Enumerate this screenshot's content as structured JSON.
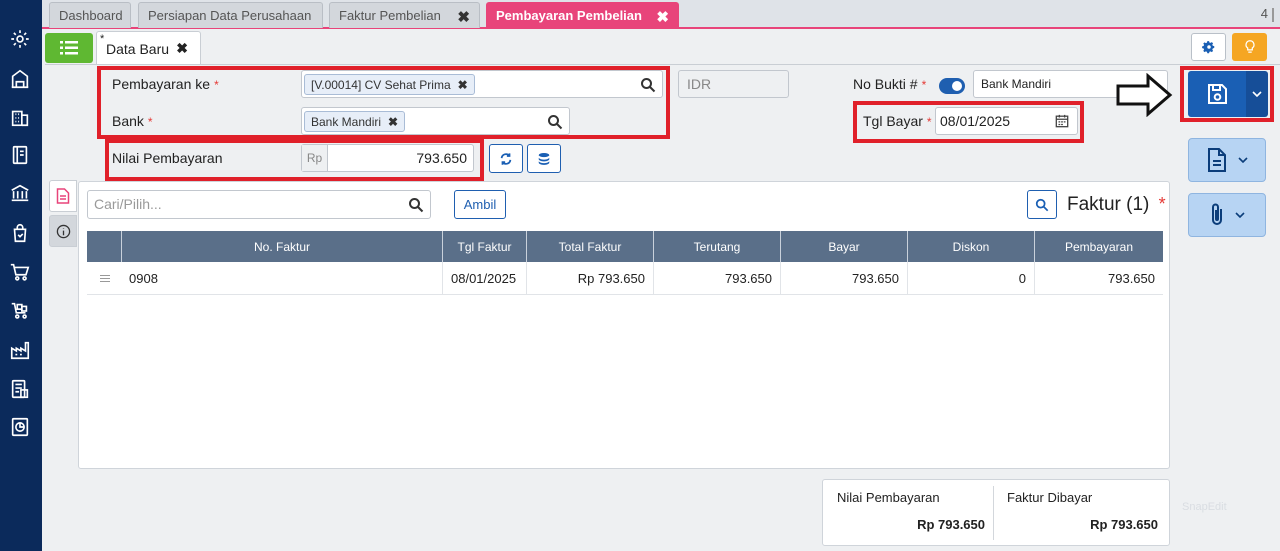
{
  "top_tabs": [
    {
      "label": "Dashboard",
      "closable": false
    },
    {
      "label": "Persiapan Data Perusahaan",
      "closable": false
    },
    {
      "label": "Faktur Pembelian",
      "closable": true
    },
    {
      "label": "Pembayaran Pembelian",
      "closable": true,
      "active": true
    }
  ],
  "tab_count": "4",
  "doc_tab": {
    "modified_mark": "*",
    "label": "Data Baru",
    "close": "✖"
  },
  "close_glyph": "✖",
  "form": {
    "pembayaran_ke": {
      "label": "Pembayaran ke",
      "required": "*",
      "value": "[V.00014] CV Sehat Prima",
      "chip_close": "✖"
    },
    "currency": "IDR",
    "bank": {
      "label": "Bank",
      "required": "*",
      "value": "Bank Mandiri",
      "chip_close": "✖"
    },
    "nilai_pembayaran": {
      "label": "Nilai Pembayaran",
      "prefix": "Rp",
      "value": "793.650"
    },
    "no_bukti": {
      "label": "No Bukti #",
      "required": "*",
      "value": "Bank Mandiri"
    },
    "tgl_bayar": {
      "label": "Tgl Bayar",
      "required": "*",
      "value": "08/01/2025"
    }
  },
  "search": {
    "placeholder": "Cari/Pilih..."
  },
  "ambil_label": "Ambil",
  "panel": {
    "title": "Faktur (1)",
    "required": "*"
  },
  "table": {
    "headers": [
      "No. Faktur",
      "Tgl Faktur",
      "Total Faktur",
      "Terutang",
      "Bayar",
      "Diskon",
      "Pembayaran"
    ],
    "rows": [
      {
        "no_faktur": "0908",
        "tgl_faktur": "08/01/2025",
        "total_faktur": "Rp 793.650",
        "terutang": "793.650",
        "bayar": "793.650",
        "diskon": "0",
        "pembayaran": "793.650"
      }
    ]
  },
  "summary": {
    "nilai_label": "Nilai Pembayaran",
    "nilai_value": "Rp 793.650",
    "faktur_label": "Faktur Dibayar",
    "faktur_value": "Rp 793.650"
  },
  "watermark": "SnapEdit",
  "colors": {
    "sidebar": "#0b2a5b",
    "active_tab": "#e8447a",
    "primary": "#1a5fb4",
    "highlight": "#e0202a",
    "list_button": "#5fb832",
    "bulb_button": "#f5a623"
  }
}
